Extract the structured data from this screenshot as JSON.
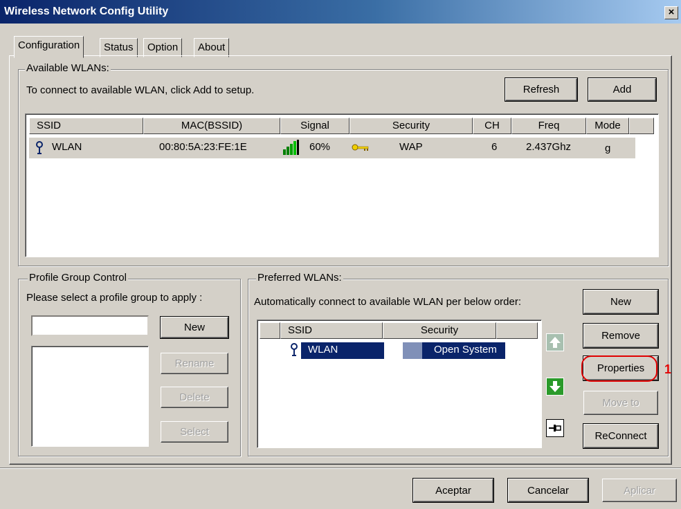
{
  "window": {
    "title": "Wireless Network Config Utility",
    "close_label": "×"
  },
  "tabs": [
    {
      "label": "Configuration"
    },
    {
      "label": "Status"
    },
    {
      "label": "Option"
    },
    {
      "label": "About"
    }
  ],
  "available": {
    "legend": "Available WLANs:",
    "hint": "To connect to available WLAN, click Add to setup.",
    "refresh_label": "Refresh",
    "add_label": "Add",
    "columns": [
      "SSID",
      "MAC(BSSID)",
      "Signal",
      "Security",
      "CH",
      "Freq",
      "Mode"
    ],
    "rows": [
      {
        "ssid": "WLAN",
        "mac": "00:80:5A:23:FE:1E",
        "signal": "60%",
        "security": "WAP",
        "ch": "6",
        "freq": "2.437Ghz",
        "mode": "g"
      }
    ]
  },
  "profile_group": {
    "legend": "Profile Group Control",
    "hint": "Please select a profile group to apply :",
    "input_value": "",
    "new_label": "New",
    "rename_label": "Rename",
    "delete_label": "Delete",
    "select_label": "Select"
  },
  "preferred": {
    "legend": "Preferred WLANs:",
    "hint": "Automatically connect to available WLAN per below order:",
    "columns": [
      "SSID",
      "Security"
    ],
    "rows": [
      {
        "ssid": "WLAN",
        "security": "Open System"
      }
    ],
    "new_label": "New",
    "remove_label": "Remove",
    "properties_label": "Properties",
    "moveto_label": "Move to",
    "reconnect_label": "ReConnect",
    "annotation": "1",
    "annotation_color": "#e00000"
  },
  "footer": {
    "ok_label": "Aceptar",
    "cancel_label": "Cancelar",
    "apply_label": "Aplicar"
  },
  "colors": {
    "selection": "#0a246a",
    "title_gradient_start": "#0a246a",
    "title_gradient_end": "#a6caf0",
    "arrow_up": "#a8c0b0",
    "arrow_down": "#2a9a2a"
  }
}
